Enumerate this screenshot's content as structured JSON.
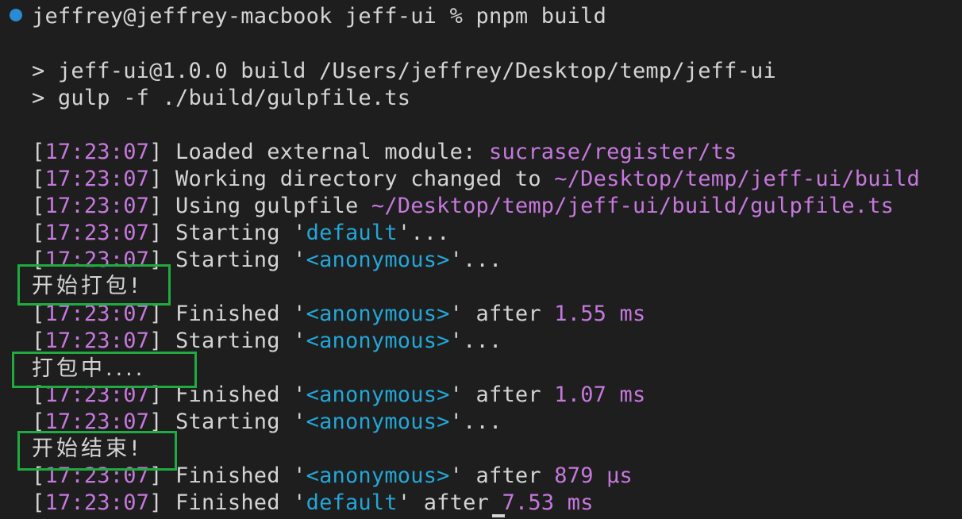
{
  "prompt": {
    "text": "jeffrey@jeffrey-macbook jeff-ui % pnpm build",
    "dot_color": "#2a8bd4"
  },
  "script_lines": [
    "> jeff-ui@1.0.0 build /Users/jeffrey/Desktop/temp/jeff-ui",
    "> gulp -f ./build/gulpfile.ts"
  ],
  "log": {
    "timestamp": "17:23:07",
    "l1_text": " Loaded external module: ",
    "l1_value": "sucrase/register/ts",
    "l2_text": " Working directory changed to ",
    "l2_value": "~/Desktop/temp/jeff-ui/build",
    "l3_text": " Using gulpfile ",
    "l3_value": "~/Desktop/temp/jeff-ui/build/gulpfile.ts",
    "starting": " Starting '",
    "finished": " Finished '",
    "ellipsis": "'...",
    "after": "' after ",
    "task_default": "default",
    "task_anon": "<anonymous>",
    "dur1": "1.55 ms",
    "dur2": "1.07 ms",
    "dur3": "879 µs",
    "dur4": "7.53 ms"
  },
  "messages": {
    "start": "开始打包!",
    "packing": "打包中....",
    "end": "开始结束!"
  },
  "colors": {
    "background": "#1e1e1e",
    "text": "#d4d4d4",
    "timestamp": "#c678dd",
    "task_name": "#22a7d8",
    "highlight_box": "#1fab3f"
  }
}
